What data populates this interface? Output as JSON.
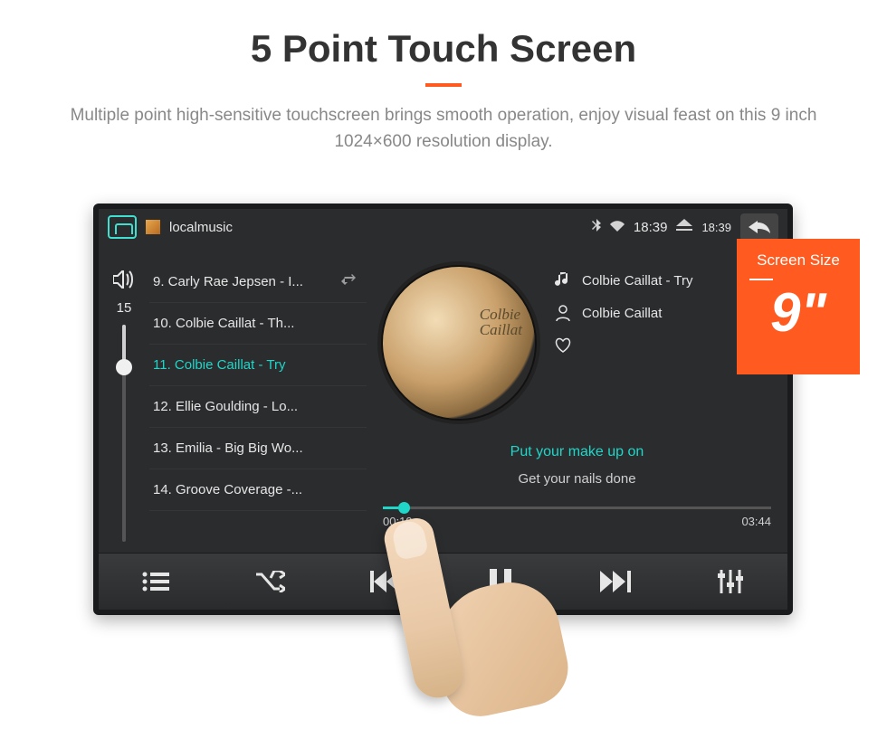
{
  "page": {
    "title": "5 Point Touch Screen",
    "subtitle": "Multiple point high-sensitive touchscreen brings smooth operation, enjoy visual feast on this 9 inch 1024×600 resolution display."
  },
  "badge": {
    "label": "Screen Size",
    "value": "9\""
  },
  "statusbar": {
    "app_label": "localmusic",
    "clock_top": "18:39",
    "clock_small": "18:39"
  },
  "volume": {
    "value": "15"
  },
  "playlist": [
    {
      "label": "9. Carly Rae Jepsen - I...",
      "active": false,
      "loop": true
    },
    {
      "label": "10. Colbie Caillat - Th...",
      "active": false,
      "loop": false
    },
    {
      "label": "11. Colbie Caillat - Try",
      "active": true,
      "loop": false
    },
    {
      "label": "12. Ellie Goulding - Lo...",
      "active": false,
      "loop": false
    },
    {
      "label": "13. Emilia - Big Big Wo...",
      "active": false,
      "loop": false
    },
    {
      "label": "14. Groove Coverage -...",
      "active": false,
      "loop": false
    }
  ],
  "nowplaying": {
    "album_line1": "Colbie",
    "album_line2": "Caillat",
    "title": "Colbie Caillat - Try",
    "artist": "Colbie Caillat",
    "lyric_active": "Put your make up on",
    "lyric_next": "Get your nails done",
    "elapsed": "00:10",
    "total": "03:44"
  }
}
